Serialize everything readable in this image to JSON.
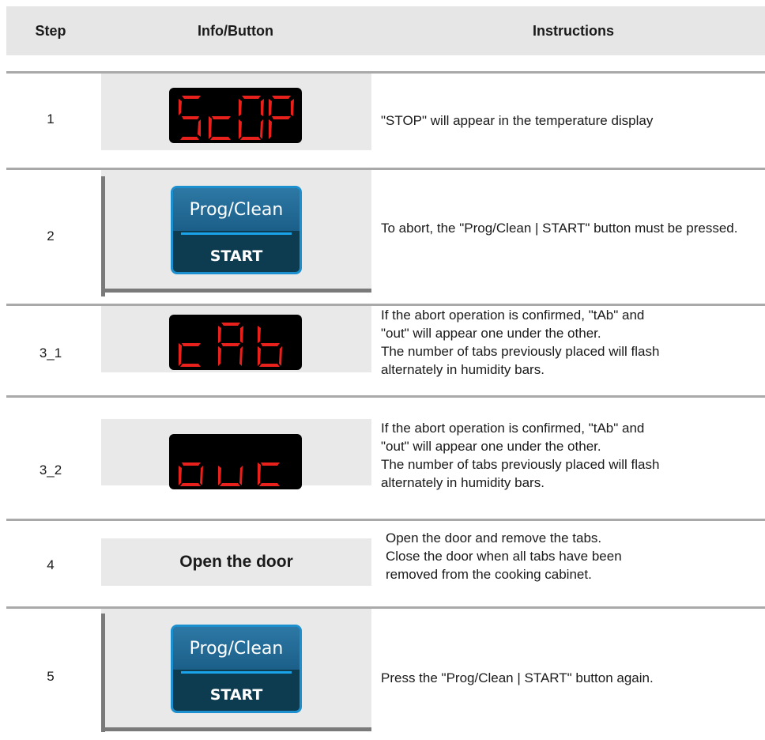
{
  "header": {
    "step": "Step",
    "info_button": "Info/Button",
    "instructions": "Instructions"
  },
  "rows": [
    {
      "step": "1",
      "display": "StOP",
      "instruction": "\"STOP\" will appear in the temperature display"
    },
    {
      "step": "2",
      "button_top": "Prog/Clean",
      "button_bottom": "START",
      "instruction": "To abort, the \"Prog/Clean | START\" button must be pressed."
    },
    {
      "step": "3_1",
      "display": "tAb",
      "instruction_lines": [
        "If the abort operation is confirmed, \"tAb\" and",
        "\"out\" will appear one under the other.",
        "The number of tabs previously placed will flash",
        "alternately in humidity bars."
      ]
    },
    {
      "step": "3_2",
      "display": "out",
      "instruction_lines": [
        "If the abort operation is confirmed, \"tAb\" and",
        "\"out\" will appear one under the other.",
        "The number of tabs previously placed will flash",
        "alternately in humidity bars."
      ]
    },
    {
      "step": "4",
      "info": "Open the door",
      "instruction_lines": [
        "Open the door and remove the tabs.",
        "Close the door when all tabs have been",
        "removed from the cooking cabinet."
      ]
    },
    {
      "step": "5",
      "button_top": "Prog/Clean",
      "button_bottom": "START",
      "instruction": "Press the \"Prog/Clean | START\" button again."
    }
  ],
  "colors": {
    "header_bg": "#e6e6e6",
    "cell_bg": "#e9e9e9",
    "divider": "#a9a9a9",
    "lcd_segment": "#e8211d",
    "button_bg": "#0d3b4f",
    "button_border": "#1c8fcf"
  }
}
